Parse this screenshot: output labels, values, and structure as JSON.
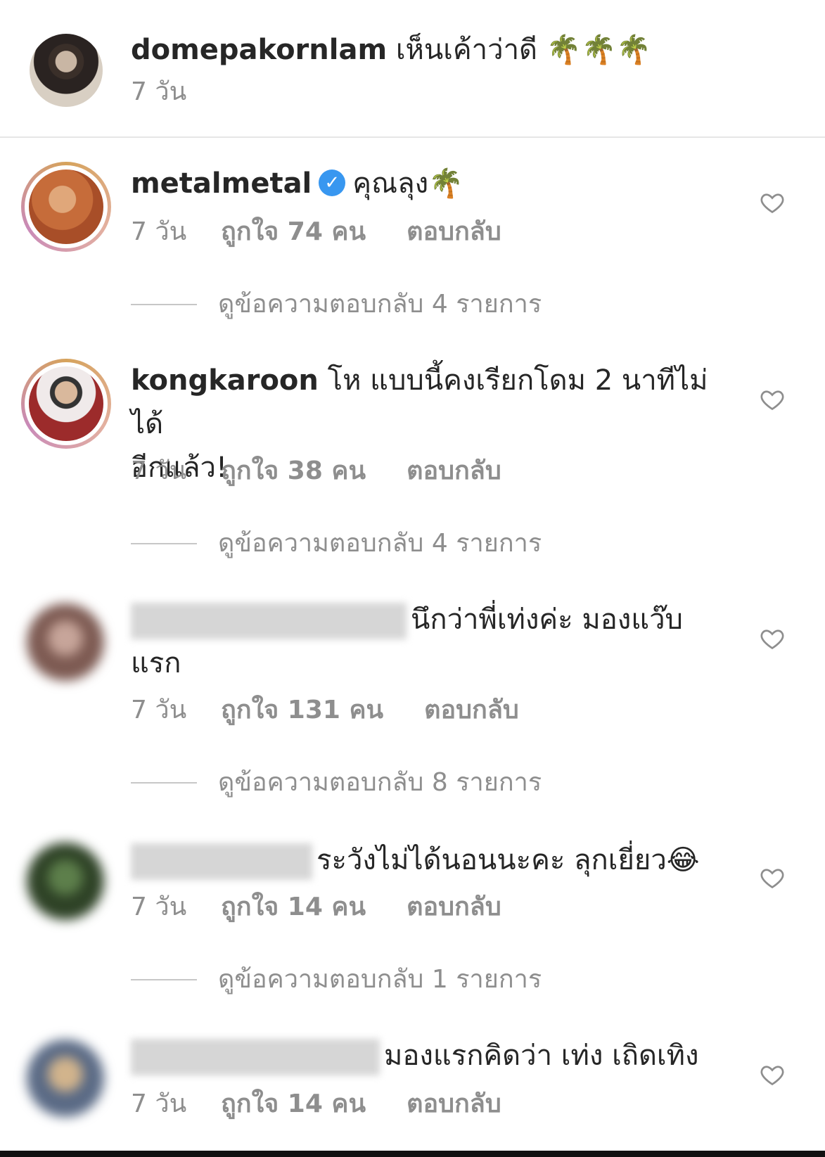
{
  "caption": {
    "username": "domepakornlam",
    "text": "เห็นเค้าว่าดี",
    "emoji": "🌴🌴🌴",
    "age": "7 วัน"
  },
  "comments": [
    {
      "username": "metalmetal",
      "verified": true,
      "text": "คุณลุง",
      "emoji": "🌴",
      "age": "7 วัน",
      "likes": "ถูกใจ 74 คน",
      "reply": "ตอบกลับ",
      "view_replies": "ดูข้อความตอบกลับ 4 รายการ"
    },
    {
      "username": "kongkaroon",
      "text": "โห แบบนี้คงเรียกโดม 2 นาทีไม่ได้",
      "text2": "อีกแล้ว!",
      "age": "7 วัน",
      "likes": "ถูกใจ 38 คน",
      "reply": "ตอบกลับ",
      "view_replies": "ดูข้อความตอบกลับ 4 รายการ"
    },
    {
      "username": "",
      "text": "นึกว่าพี่เท่งค่ะ มองแว๊บ",
      "text2": "แรก",
      "age": "7 วัน",
      "likes": "ถูกใจ 131 คน",
      "reply": "ตอบกลับ",
      "view_replies": "ดูข้อความตอบกลับ 8 รายการ"
    },
    {
      "username": "",
      "text": "ระวังไม่ได้นอนนะคะ ลุกเยี่ยว",
      "emoji": "😂",
      "age": "7 วัน",
      "likes": "ถูกใจ 14 คน",
      "reply": "ตอบกลับ",
      "view_replies": "ดูข้อความตอบกลับ 1 รายการ"
    },
    {
      "username": "",
      "text": "มองแรกคิดว่า เท่ง เถิดเทิง",
      "age": "7 วัน",
      "likes": "ถูกใจ 14 คน",
      "reply": "ตอบกลับ"
    }
  ],
  "icons": {
    "like": "heart-outline-icon",
    "verified": "verified-badge-icon"
  },
  "colors": {
    "verified": "#3897f0",
    "meta_text": "#8e8e8e"
  }
}
